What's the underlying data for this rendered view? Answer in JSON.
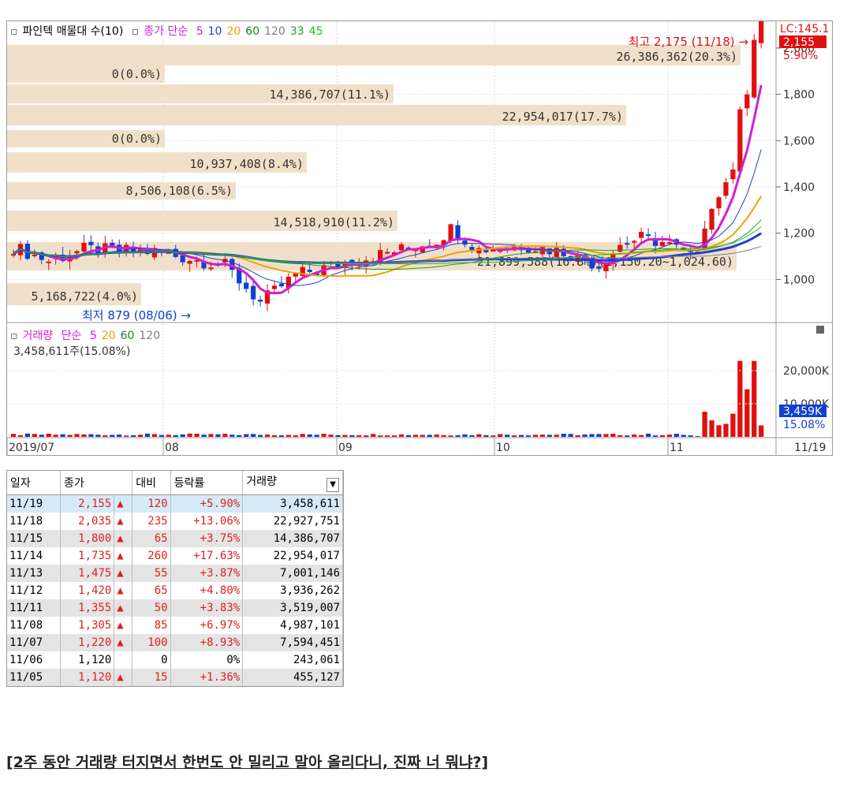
{
  "chart_data": [
    {
      "type": "candlestick",
      "title": "파인텍 매물대 수(10)",
      "indicator_legend": {
        "label": "종가 단순",
        "periods": [
          "5",
          "10",
          "20",
          "60",
          "120",
          "33",
          "45"
        ],
        "colors": [
          "#d020d0",
          "#2040d0",
          "#f0a000",
          "#208020",
          "#808080",
          "#20a020",
          "#20c020"
        ]
      },
      "price_axis_ticks": [
        1000,
        1200,
        1400,
        1600,
        1800,
        2000
      ],
      "price_axis_extra": [
        "LC:145.1",
        "2,155",
        "5.90%"
      ],
      "x_axis_ticks": [
        "2019/07",
        "08",
        "09",
        "10",
        "11",
        "11/19"
      ],
      "volume_profile": [
        "26,386,362(20.3%)",
        "0(0.0%)",
        "14,386,707(11.1%)",
        "22,954,017(17.7%)",
        "0(0.0%)",
        "10,937,408(8.4%)",
        "8,506,108(6.5%)",
        "14,518,910(11.2%)",
        "21,899,588(16.8%)(1,150.20~1,024.60)",
        "5,168,722(4.0%)"
      ],
      "annotations": {
        "high": "최고 2,175 (11/18) →",
        "low": "최저 879 (08/06) →"
      }
    },
    {
      "type": "bar",
      "title": "거래량",
      "legend": {
        "label": "거래량",
        "ma_label": "단순",
        "periods": [
          "5",
          "20",
          "60",
          "120"
        ]
      },
      "summary": "3,458,611주(15.08%)",
      "y_axis_ticks": [
        "20,000K",
        "10,000K"
      ],
      "current_badge": [
        "3,459K",
        "15.08%"
      ]
    }
  ],
  "table": {
    "headers": [
      "일자",
      "종가",
      "대비",
      "등락률",
      "거래량"
    ],
    "rows": [
      {
        "date": "11/19",
        "close": "2,155",
        "arrow": "▲",
        "change": "120",
        "rate": "+5.90%",
        "volume": "3,458,611"
      },
      {
        "date": "11/18",
        "close": "2,035",
        "arrow": "▲",
        "change": "235",
        "rate": "+13.06%",
        "volume": "22,927,751"
      },
      {
        "date": "11/15",
        "close": "1,800",
        "arrow": "▲",
        "change": "65",
        "rate": "+3.75%",
        "volume": "14,386,707"
      },
      {
        "date": "11/14",
        "close": "1,735",
        "arrow": "▲",
        "change": "260",
        "rate": "+17.63%",
        "volume": "22,954,017"
      },
      {
        "date": "11/13",
        "close": "1,475",
        "arrow": "▲",
        "change": "55",
        "rate": "+3.87%",
        "volume": "7,001,146"
      },
      {
        "date": "11/12",
        "close": "1,420",
        "arrow": "▲",
        "change": "65",
        "rate": "+4.80%",
        "volume": "3,936,262"
      },
      {
        "date": "11/11",
        "close": "1,355",
        "arrow": "▲",
        "change": "50",
        "rate": "+3.83%",
        "volume": "3,519,007"
      },
      {
        "date": "11/08",
        "close": "1,305",
        "arrow": "▲",
        "change": "85",
        "rate": "+6.97%",
        "volume": "4,987,101"
      },
      {
        "date": "11/07",
        "close": "1,220",
        "arrow": "▲",
        "change": "100",
        "rate": "+8.93%",
        "volume": "7,594,451"
      },
      {
        "date": "11/06",
        "close": "1,120",
        "arrow": "",
        "change": "0",
        "rate": "0%",
        "volume": "243,061"
      },
      {
        "date": "11/05",
        "close": "1,120",
        "arrow": "▲",
        "change": "15",
        "rate": "+1.36%",
        "volume": "455,127"
      }
    ]
  },
  "caption": "[2주 동안 거래량 터지면서 한번도 안 밀리고 말아 올리다니, 진짜 너 뭐냐?]"
}
